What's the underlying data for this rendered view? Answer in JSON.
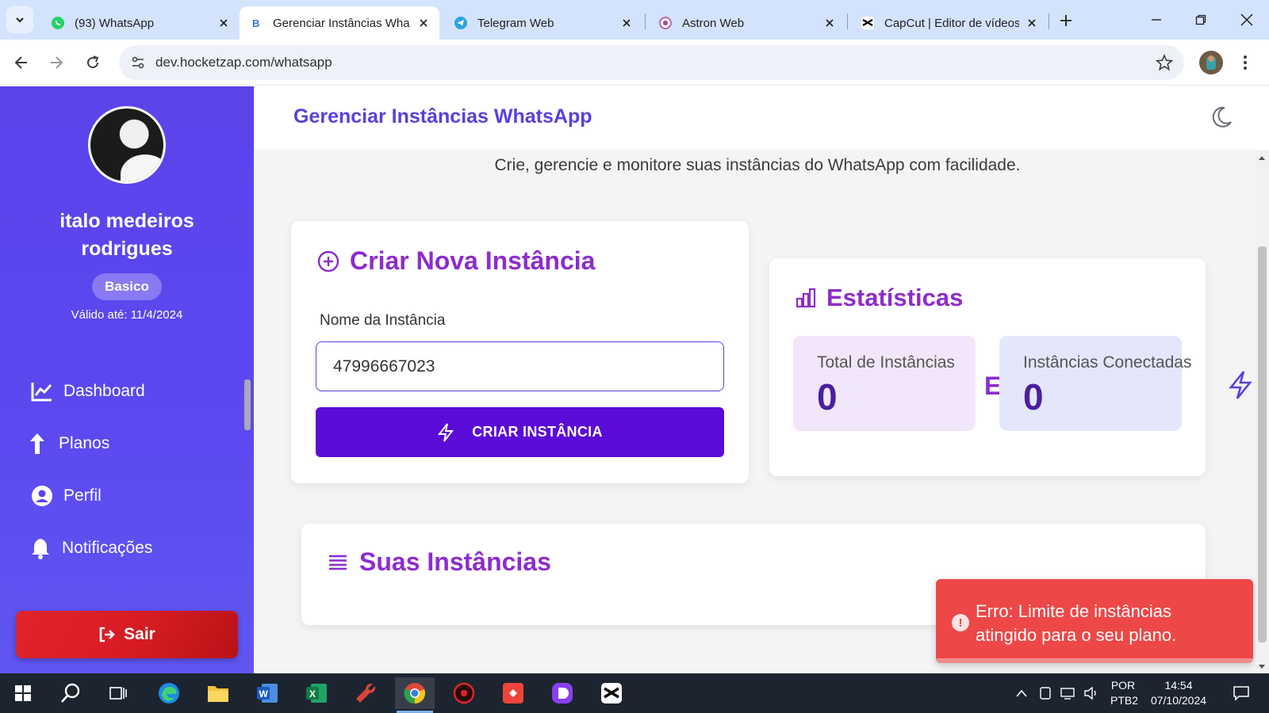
{
  "browser": {
    "tabs": [
      {
        "title": "(93) WhatsApp",
        "icon": "whatsapp-icon"
      },
      {
        "title": "Gerenciar Instâncias Wha",
        "icon": "bootstrap-icon",
        "active": true
      },
      {
        "title": "Telegram Web",
        "icon": "telegram-icon"
      },
      {
        "title": "Astron Web",
        "icon": "astron-icon"
      },
      {
        "title": "CapCut | Editor de vídeos",
        "icon": "capcut-icon"
      }
    ],
    "url": "dev.hocketzap.com/whatsapp"
  },
  "sidebar": {
    "user_name": "italo medeiros rodrigues",
    "plan": "Basico",
    "valid_until": "Válido até: 11/4/2024",
    "nav": [
      {
        "label": "Dashboard",
        "icon": "chart-line-icon"
      },
      {
        "label": "Planos",
        "icon": "arrow-up-icon"
      },
      {
        "label": "Perfil",
        "icon": "user-circle-icon"
      },
      {
        "label": "Notificações",
        "icon": "bell-icon"
      }
    ],
    "logout_label": "Sair"
  },
  "main": {
    "title": "Gerenciar Instâncias WhatsApp",
    "subtitle": "Crie, gerencie e monitore suas instâncias do WhatsApp com facilidade.",
    "create_card": {
      "title": "Criar Nova Instância",
      "field_label": "Nome da Instância",
      "field_value": "47996667023",
      "button_label": "CRIAR INSTÂNCIA"
    },
    "stats_card": {
      "title": "Estatísticas",
      "total_label": "Total de Instâncias",
      "total_value": "0",
      "connected_label": "Instâncias Conectadas",
      "connected_value": "0",
      "glyph": "E"
    },
    "list_card": {
      "title": "Suas Instâncias"
    },
    "toast": {
      "message": "Erro: Limite de instâncias atingido para o seu plano."
    }
  },
  "taskbar": {
    "language": "POR",
    "layout": "PTB2",
    "time": "14:54",
    "date": "07/10/2024"
  },
  "colors": {
    "accent": "#5b3fe0",
    "heading": "#8c2ccf",
    "sidebar": "#5b43ea",
    "button": "#5b0bd8",
    "danger": "#ee4747"
  }
}
